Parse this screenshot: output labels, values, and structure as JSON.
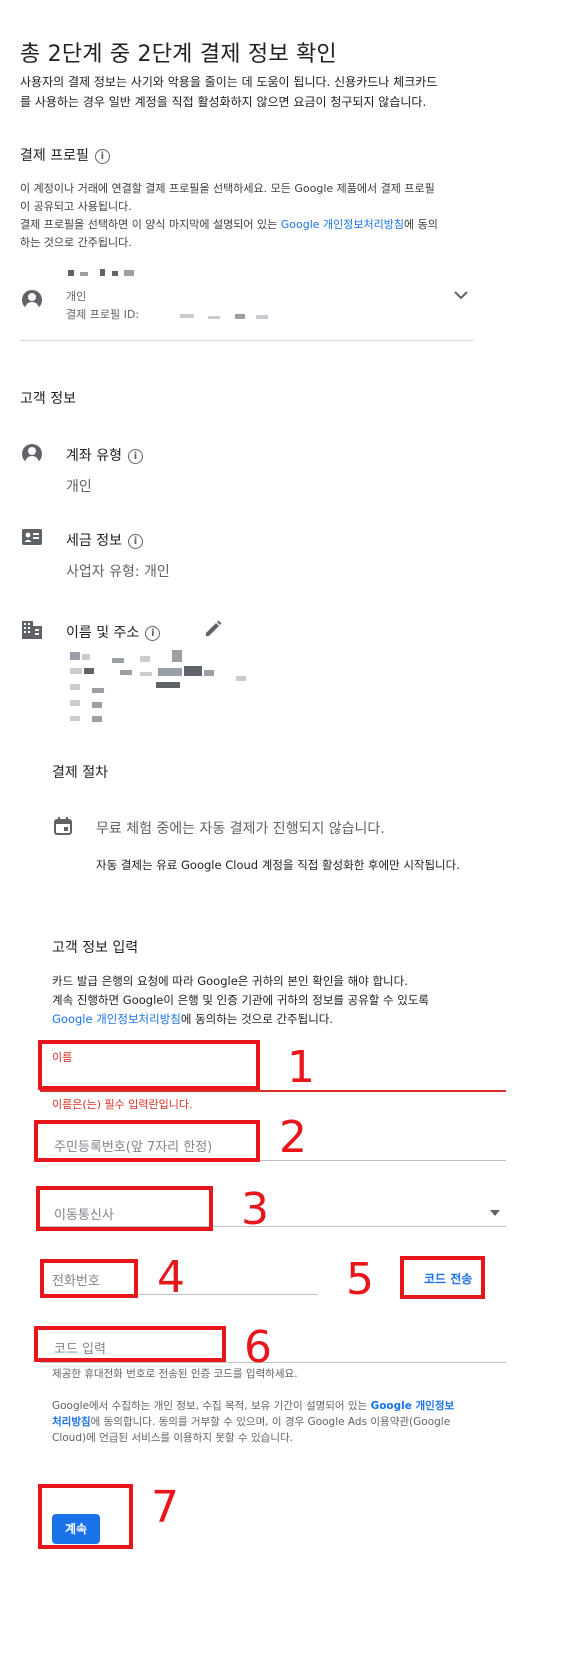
{
  "header": {
    "title": "총 2단계 중 2단계 결제 정보 확인",
    "subtitle_line1": "사용자의 결제 정보는 사기와 악용을 줄이는 데 도움이 됩니다. 신용카드나 체크카드",
    "subtitle_line2": "를 사용하는 경우 일반 계정을 직접 활성화하지 않으면 요금이 청구되지 않습니다."
  },
  "payment_profile": {
    "heading": "결제 프로필",
    "desc_line1": "이 계정이나 거래에 연결할 결제 프로필을 선택하세요. 모든 Google 제품에서 결제 프로필",
    "desc_line2": "이 공유되고 사용됩니다.",
    "desc_line3_pre": "결제 프로필을 선택하면 이 양식 마지막에 설명되어 있는 ",
    "desc_line3_link": "Google 개인정보처리방침",
    "desc_line3_post": "에 동의",
    "desc_line4": "하는 것으로 간주됩니다.",
    "profile_type": "개인",
    "profile_id_label": "결제 프로필 ID:"
  },
  "customer_info": {
    "heading": "고객 정보",
    "account_type_label": "계좌 유형",
    "account_type_value": "개인",
    "tax_info_label": "세금 정보",
    "tax_info_value": "사업자 유형: 개인",
    "name_address_label": "이름 및 주소"
  },
  "payment_procedure": {
    "heading": "결제 절차",
    "notice": "무료 체험 중에는 자동 결제가 진행되지 않습니다.",
    "detail": "자동 결제는 유료 Google Cloud 계정을 직접 활성화한 후에만 시작됩니다."
  },
  "customer_input": {
    "heading": "고객 정보 입력",
    "desc_line1": "카드 발급 은행의 요청에 따라 Google은 귀하의 본인 확인을 해야 합니다.",
    "desc_line2": "계속 진행하면 Google이 은행 및 인증 기관에 귀하의 정보를 공유할 수 있도록",
    "desc_line3_link": "Google 개인정보처리방침",
    "desc_line3_post": "에 동의하는 것으로 간주됩니다.",
    "name_label": "이름",
    "name_error": "이름은(는) 필수 입력란입니다.",
    "rrn_placeholder": "주민등록번호(앞 7자리 한정)",
    "carrier_placeholder": "이동통신사",
    "phone_placeholder": "전화번호",
    "send_code_label": "코드 전송",
    "code_placeholder": "코드 입력",
    "code_hint": "제공한 휴대전화 번호로 전송된 인증 코드를 입력하세요.",
    "privacy_pre": "Google에서 수집하는 개인 정보, 수집 목적, 보유 기간이 설명되어 있는 ",
    "privacy_link_1": "Google 개인정보",
    "privacy_link_2": "처리방침",
    "privacy_post_1": "에 동의합니다. 동의를 거부할 수 있으며, 이 경우 Google Ads 이용약관(Google",
    "privacy_post_2": "Cloud)에 언급된 서비스를 이용하지 못할 수 있습니다.",
    "continue_label": "계속"
  },
  "annotations": [
    "1",
    "2",
    "3",
    "4",
    "5",
    "6",
    "7"
  ],
  "colors": {
    "accent": "#1a73e8",
    "error": "#d93025",
    "annotation": "#e8151b"
  }
}
